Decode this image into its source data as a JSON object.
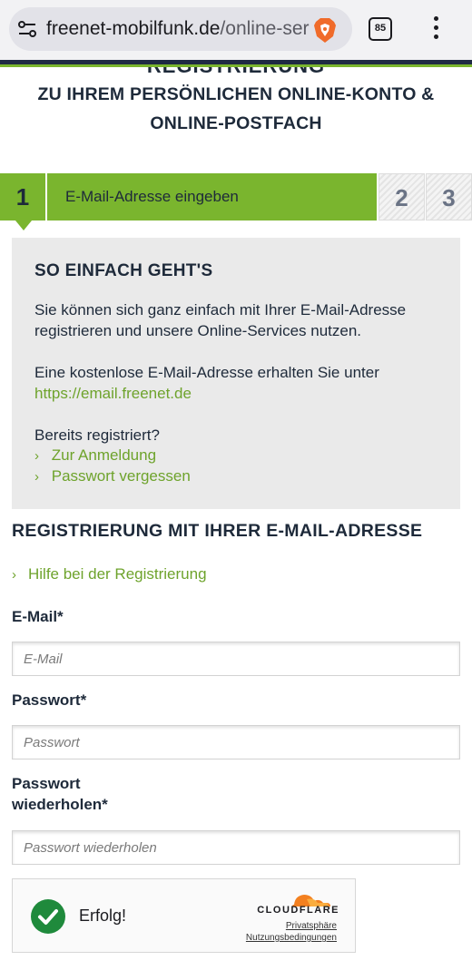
{
  "browser": {
    "url_host": "freenet-mobilfunk.de",
    "url_path": "/online-ser",
    "tab_count": "85"
  },
  "page": {
    "cut_heading": "REGISTRIERUNG",
    "headline": "ZU IHREM PERSÖNLICHEN ONLINE-KONTO & ONLINE-POSTFACH"
  },
  "steps": {
    "active_number": "1",
    "active_label": "E-Mail-Adresse eingeben",
    "step2": "2",
    "step3": "3"
  },
  "info": {
    "title": "SO EINFACH GEHT'S",
    "paragraph1": "Sie können sich ganz einfach mit Ihrer E-Mail-Adresse registrieren und unsere Online-Services nutzen.",
    "paragraph2": "Eine kostenlose E-Mail-Adresse erhalten Sie unter",
    "email_link": "https://email.freenet.de",
    "already_registered": "Bereits registriert?",
    "login_link": "Zur Anmeldung",
    "forgot_link": "Passwort vergessen"
  },
  "form": {
    "title": "REGISTRIERUNG MIT IHRER E-MAIL-ADRESSE",
    "help_link": "Hilfe bei der Registrierung",
    "email_label": "E-Mail*",
    "email_placeholder": "E-Mail",
    "password_label": "Passwort*",
    "password_placeholder": "Passwort",
    "password2_label": "Passwort wiederholen*",
    "password2_placeholder": "Passwort wiederholen"
  },
  "captcha": {
    "status": "Erfolg!",
    "brand": "CLOUDFLARE",
    "privacy": "Privatsphäre",
    "terms": "Nutzungsbedingungen"
  },
  "colors": {
    "accent_green": "#7ab52e",
    "link_green": "#6ea32c",
    "navy": "#1e2a3a",
    "success": "#1f8a3c",
    "cloudflare_orange": "#f38020"
  }
}
